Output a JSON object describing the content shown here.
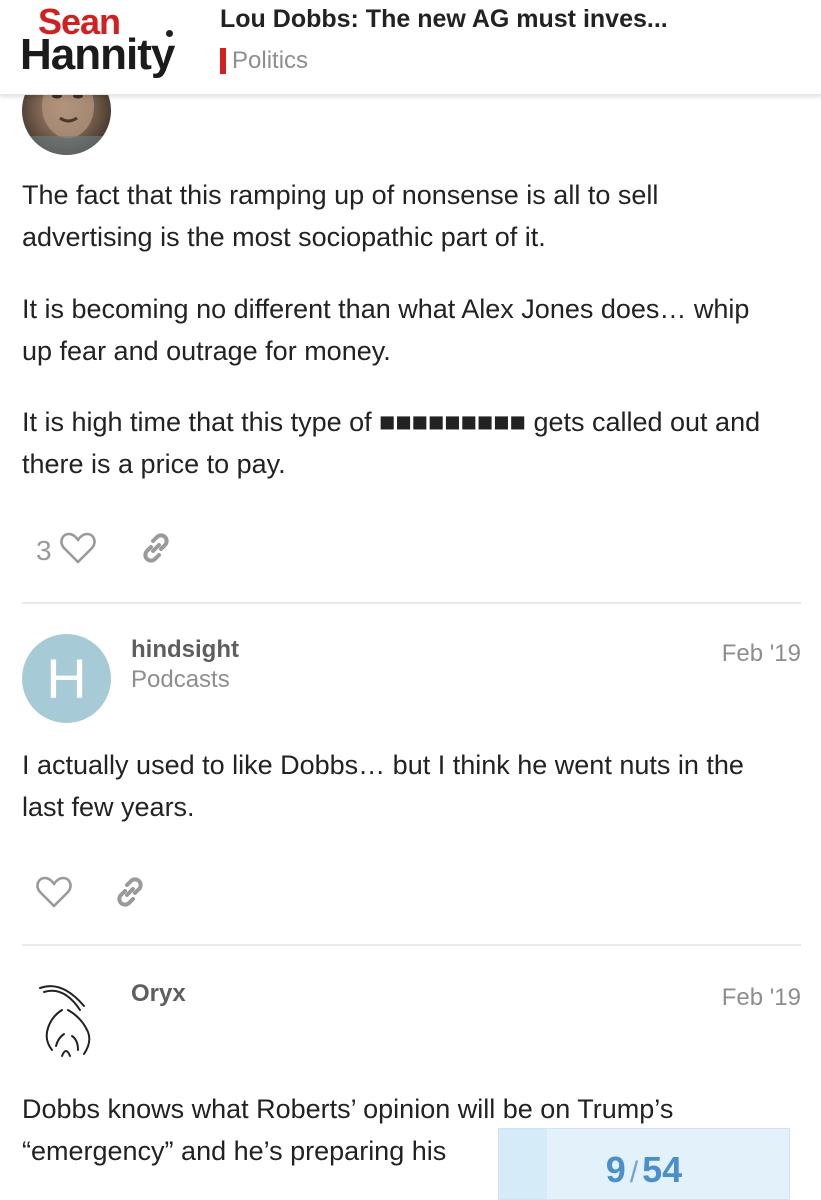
{
  "header": {
    "logo_top": "Sean",
    "logo_bottom": "Hannity",
    "topic_title": "Lou Dobbs: The new AG must inves...",
    "category": "Politics",
    "category_color": "#d0201f"
  },
  "posts": [
    {
      "paragraphs": [
        "The fact that this ramping up of nonsense is all to sell advertising is the most sociopathic part of it.",
        "It is becoming no different than what Alex Jones does… whip up fear and outrage for money.",
        "It is high time that this type of ■■■■■■■■■ gets called out and there is a price to pay."
      ],
      "likes": "3",
      "like_icon": "heart-icon",
      "share_icon": "link-icon"
    },
    {
      "avatar_letter": "H",
      "avatar_color": "#a6cad6",
      "username": "hindsight",
      "user_title": "Podcasts",
      "date": "Feb '19",
      "paragraphs": [
        "I actually used to like Dobbs… but I think he went nuts in the last few years."
      ],
      "like_icon": "heart-icon",
      "share_icon": "link-icon"
    },
    {
      "username": "Oryx",
      "date": "Feb '19",
      "paragraphs": [
        "Dobbs knows what Roberts’ opinion will be on Trump’s “emergency” and he’s preparing his"
      ]
    }
  ],
  "progress": {
    "current": "9",
    "separator": "/",
    "total": "54",
    "fraction": 0.1667
  }
}
